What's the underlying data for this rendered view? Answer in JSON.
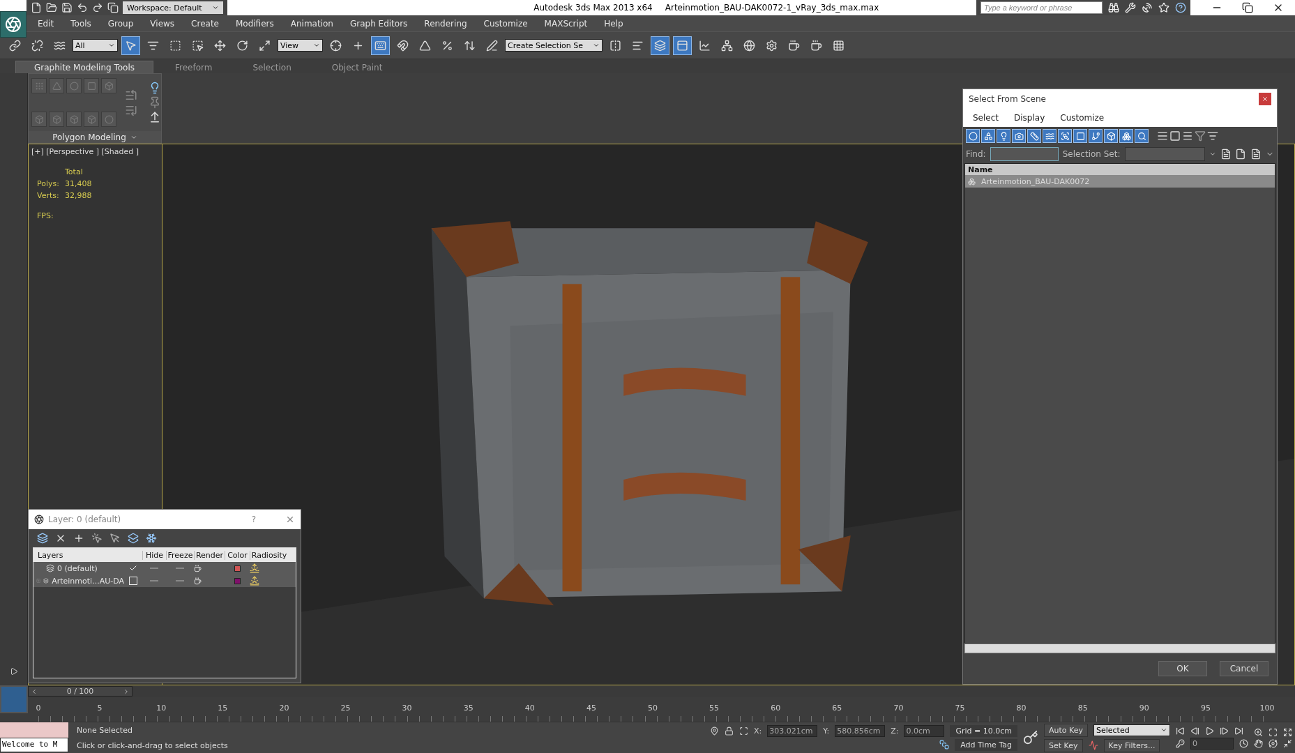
{
  "title_bar": {
    "workspace": "Workspace: Default",
    "app": "Autodesk 3ds Max  2013 x64",
    "file": "Arteinmotion_BAU-DAK0072-1_vRay_3ds_max.max",
    "search": {
      "placeholder": "Type a keyword or phrase"
    }
  },
  "menu": [
    "Edit",
    "Tools",
    "Group",
    "Views",
    "Create",
    "Modifiers",
    "Animation",
    "Graph Editors",
    "Rendering",
    "Customize",
    "MAXScript",
    "Help"
  ],
  "main_toolbar": [
    {
      "kind": "icon",
      "selected": false
    },
    {
      "kind": "icon",
      "selected": false
    },
    {
      "kind": "icon",
      "selected": false
    },
    {
      "kind": "dropdown",
      "value": "All"
    },
    {
      "kind": "icon",
      "selected": true
    },
    {
      "kind": "icon",
      "selected": false
    },
    {
      "kind": "icon",
      "selected": false
    },
    {
      "kind": "icon",
      "selected": false
    },
    {
      "kind": "icon",
      "selected": false
    },
    {
      "kind": "icon",
      "selected": false
    },
    {
      "kind": "icon",
      "selected": false
    },
    {
      "kind": "dropdown",
      "value": "View"
    },
    {
      "kind": "icon",
      "selected": false
    },
    {
      "kind": "icon",
      "selected": false
    },
    {
      "kind": "icon",
      "selected": true
    },
    {
      "kind": "icon",
      "selected": false
    },
    {
      "kind": "icon",
      "selected": false
    },
    {
      "kind": "icon",
      "selected": false
    },
    {
      "kind": "icon",
      "selected": false
    },
    {
      "kind": "icon",
      "selected": false
    },
    {
      "kind": "dropdown",
      "value": "Create Selection Se"
    },
    {
      "kind": "icon",
      "selected": false
    },
    {
      "kind": "icon",
      "selected": false
    },
    {
      "kind": "icon",
      "selected": true
    },
    {
      "kind": "icon",
      "selected": true
    },
    {
      "kind": "icon",
      "selected": false
    },
    {
      "kind": "icon",
      "selected": false
    },
    {
      "kind": "icon",
      "selected": false
    },
    {
      "kind": "icon",
      "selected": false
    },
    {
      "kind": "icon",
      "selected": false
    },
    {
      "kind": "icon",
      "selected": false
    },
    {
      "kind": "icon",
      "selected": false
    }
  ],
  "ribbon": {
    "tabs": [
      {
        "label": "Graphite Modeling Tools",
        "selected": true
      },
      {
        "label": "Freeform",
        "selected": false
      },
      {
        "label": "Selection",
        "selected": false
      },
      {
        "label": "Object Paint",
        "selected": false
      }
    ],
    "panel": "Polygon Modeling"
  },
  "viewport": {
    "label": "[+] [Perspective ] [Shaded ]",
    "stats": {
      "heading": "Total",
      "rows": [
        {
          "label": "Polys:",
          "value": "31,408"
        },
        {
          "label": "Verts:",
          "value": "32,988"
        },
        {
          "label": "FPS:",
          "value": ""
        }
      ]
    }
  },
  "layer_dialog": {
    "title": "Layer: 0 (default)",
    "help": "?",
    "columns": [
      "Layers",
      "Hide",
      "Freeze",
      "Render",
      "Color",
      "Radiosity"
    ],
    "rows": [
      {
        "name": "0 (default)",
        "current": true,
        "expandable": false,
        "color": "#d05454"
      },
      {
        "name": "Arteinmoti...AU-DA",
        "current": false,
        "expandable": true,
        "color": "#80106a"
      }
    ]
  },
  "select_dialog": {
    "title": "Select From Scene",
    "menu": [
      "Select",
      "Display",
      "Customize"
    ],
    "filters": [
      {
        "selected": true
      },
      {
        "selected": true
      },
      {
        "selected": true
      },
      {
        "selected": true
      },
      {
        "selected": true
      },
      {
        "selected": true
      },
      {
        "selected": true
      },
      {
        "selected": true
      },
      {
        "selected": true
      },
      {
        "selected": true
      },
      {
        "selected": true
      },
      {
        "selected": true
      }
    ],
    "find_label": "Find:",
    "selection_set_label": "Selection Set:",
    "column": "Name",
    "rows": [
      {
        "name": "Arteinmotion_BAU-DAK0072",
        "selected": true
      }
    ],
    "buttons": [
      "OK",
      "Cancel"
    ]
  },
  "time_slider": {
    "label": "0 / 100",
    "level": 0
  },
  "track_bar": [
    "0",
    "5",
    "10",
    "15",
    "20",
    "25",
    "30",
    "35",
    "40",
    "45",
    "50",
    "55",
    "60",
    "65",
    "70",
    "75",
    "80",
    "85",
    "90",
    "95",
    "100"
  ],
  "status_bar": {
    "listener": "Welcome to M",
    "selection": "None Selected",
    "prompt": "Click or click-and-drag to select objects",
    "x": "303.021cm",
    "y": "580.856cm",
    "z": "0.0cm",
    "grid": "Grid = 10.0cm",
    "time_tag": "Add Time Tag",
    "auto_key": "Auto Key",
    "key_mode": "Selected",
    "set_key": "Set Key",
    "key_filters": "Key Filters...",
    "frame": "0",
    "x_label": "X:",
    "y_label": "Y:",
    "z_label": "Z:"
  }
}
